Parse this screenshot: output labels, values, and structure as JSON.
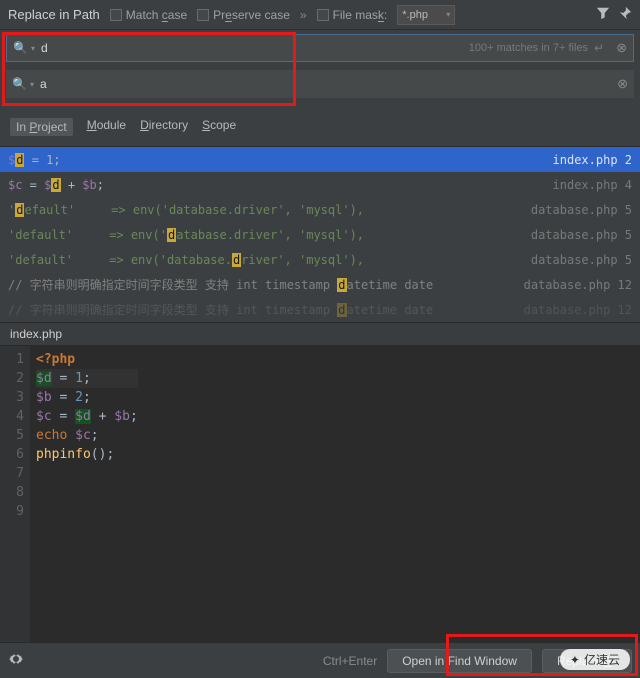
{
  "title": "Replace in Path",
  "options": {
    "match_case": "Match case",
    "preserve_case": "Preserve case",
    "file_mask_label": "File mask:",
    "file_mask_value": "*.php"
  },
  "search": {
    "value": "d",
    "matches_text": "100+ matches in 7+ files"
  },
  "replace": {
    "value": "a"
  },
  "scopes": {
    "in_project": "In Project",
    "module": "Module",
    "directory": "Directory",
    "scope": "Scope"
  },
  "results": [
    {
      "pre": "$",
      "hl": "d",
      "post": " = 1;",
      "file": "index.php",
      "line": "2",
      "selected": true
    },
    {
      "raw_html": "$c = $<hl>d</hl> + $b;",
      "file": "index.php",
      "line": "4"
    },
    {
      "raw_html": "'<hl>d</hl>efault'     => env('database.driver', 'mysql'),",
      "file": "database.php",
      "line": "5"
    },
    {
      "raw_html": "'default'     => env('<hl>d</hl>atabase.driver', 'mysql'),",
      "file": "database.php",
      "line": "5"
    },
    {
      "raw_html": "'default'     => env('database.<hl>d</hl>river', 'mysql'),",
      "file": "database.php",
      "line": "5"
    },
    {
      "raw_html": "// 字符串则明确指定时间字段类型 支持 int timestamp <hl>d</hl>atetime date",
      "file": "database.php",
      "line": "12",
      "comment": true
    },
    {
      "raw_html": "// 字符串则明确指定时间字段类型 支持 int timestamp <hl>d</hl>atetime date",
      "file": "database.php",
      "line": "12",
      "comment": true,
      "faded": true
    }
  ],
  "preview_file": "index.php",
  "editor_lines": [
    {
      "n": "1",
      "html": "<span class='e-php'>&lt;?php</span>"
    },
    {
      "n": "2",
      "html": "<span class='e-var bind-hl'>$d</span> <span class='e-punc'>=</span> <span class='e-num'>1</span><span class='e-punc'>;</span>",
      "cursor": true
    },
    {
      "n": "3",
      "html": "<span class='e-var'>$b</span> <span class='e-punc'>=</span> <span class='e-num'>2</span><span class='e-punc'>;</span>"
    },
    {
      "n": "4",
      "html": "<span class='e-var'>$c</span> <span class='e-punc'>=</span> <span class='e-var bind-hl'>$d</span> <span class='e-punc'>+</span> <span class='e-var'>$b</span><span class='e-punc'>;</span>"
    },
    {
      "n": "5",
      "html": "<span class='e-kw'>echo</span> <span class='e-var'>$c</span><span class='e-punc'>;</span>"
    },
    {
      "n": "6",
      "html": "<span class='e-id'>phpinfo</span><span class='e-punc'>();</span>"
    },
    {
      "n": "7",
      "html": ""
    },
    {
      "n": "8",
      "html": ""
    },
    {
      "n": "9",
      "html": ""
    }
  ],
  "bottom": {
    "hint": "Ctrl+Enter",
    "open_btn": "Open in Find Window",
    "replace_all_btn": "Replace All"
  },
  "watermark": "亿速云"
}
